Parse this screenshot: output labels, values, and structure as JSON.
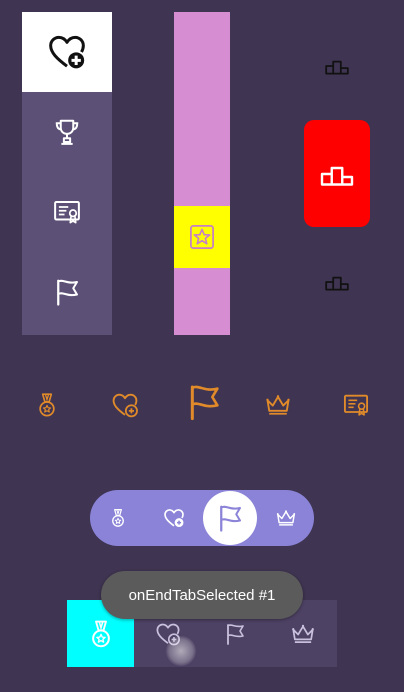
{
  "colors": {
    "background": "#3f3451",
    "bar1_bg": "#5d5076",
    "bar1_selected_bg": "#ffffff",
    "bar2_bg": "#d78dd2",
    "bar2_selected_bg": "#ffff00",
    "bar3_selected_bg": "#ff0000",
    "orange_icon": "#e08a2a",
    "pill_bg": "#8a83d8",
    "bottom_bar_bg": "#4e4264",
    "bottom_selected_bg": "#00ffff",
    "toast_bg": "#5b5b5b"
  },
  "vertical_bar_1": {
    "tabs": [
      {
        "icon": "heart-plus-icon",
        "selected": true
      },
      {
        "icon": "trophy-icon",
        "selected": false
      },
      {
        "icon": "certificate-icon",
        "selected": false
      },
      {
        "icon": "flag-icon",
        "selected": false
      }
    ]
  },
  "vertical_bar_2": {
    "tabs": [
      {
        "icon": "star-badge-icon",
        "selected": true
      }
    ]
  },
  "vertical_bar_3": {
    "tabs": [
      {
        "icon": "podium-icon",
        "selected": false
      },
      {
        "icon": "podium-icon",
        "selected": true
      },
      {
        "icon": "podium-icon",
        "selected": false
      }
    ]
  },
  "orange_row": {
    "tabs": [
      {
        "icon": "medal-icon"
      },
      {
        "icon": "heart-plus-icon"
      },
      {
        "icon": "flag-icon",
        "selected": true
      },
      {
        "icon": "crown-icon"
      },
      {
        "icon": "certificate-icon"
      }
    ]
  },
  "pill_bar": {
    "tabs": [
      {
        "icon": "medal-icon"
      },
      {
        "icon": "heart-plus-icon"
      },
      {
        "icon": "flag-icon",
        "selected": true
      },
      {
        "icon": "crown-icon"
      }
    ]
  },
  "bottom_bar": {
    "tabs": [
      {
        "icon": "medal-icon",
        "selected": true
      },
      {
        "icon": "heart-plus-icon"
      },
      {
        "icon": "flag-icon"
      },
      {
        "icon": "crown-icon"
      }
    ]
  },
  "toast": {
    "text": "onEndTabSelected #1"
  }
}
